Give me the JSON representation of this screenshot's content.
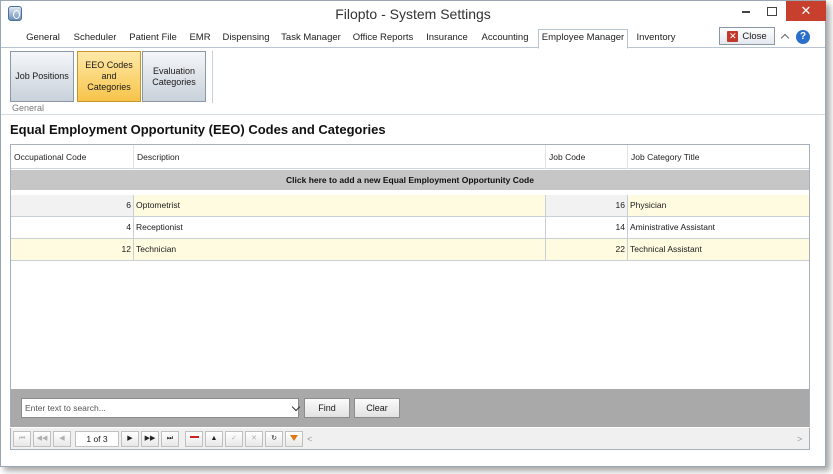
{
  "window": {
    "title": "Filopto - System Settings",
    "close_glyph": "✕"
  },
  "tabs": [
    {
      "label": "General"
    },
    {
      "label": "Scheduler"
    },
    {
      "label": "Patient File"
    },
    {
      "label": "EMR"
    },
    {
      "label": "Dispensing"
    },
    {
      "label": "Task Manager"
    },
    {
      "label": "Office Reports"
    },
    {
      "label": "Insurance"
    },
    {
      "label": "Accounting"
    },
    {
      "label": "Employee Manager"
    },
    {
      "label": "Inventory"
    }
  ],
  "active_tab": "Employee Manager",
  "close_button": {
    "label": "Close",
    "glyph": "✕"
  },
  "help_glyph": "?",
  "ribbon": {
    "buttons": [
      {
        "label": "Job Positions"
      },
      {
        "label": "EEO Codes and Categories"
      },
      {
        "label": "Evaluation Categories"
      }
    ],
    "group_label": "General"
  },
  "heading": "Equal Employment Opportunity (EEO) Codes and Categories",
  "grid": {
    "columns": [
      "Occupational Code",
      "Description",
      "Job Code",
      "Job Category Title"
    ],
    "add_row_text": "Click here to add a new Equal Employment Opportunity Code",
    "rows": [
      {
        "code": "6",
        "description": "Optometrist",
        "job_code": "16",
        "title": "Physician"
      },
      {
        "code": "4",
        "description": "Receptionist",
        "job_code": "14",
        "title": "Aministrative Assistant"
      },
      {
        "code": "12",
        "description": "Technician",
        "job_code": "22",
        "title": "Technical Assistant"
      }
    ]
  },
  "search": {
    "placeholder": "Enter text to search...",
    "find_label": "Find",
    "clear_label": "Clear"
  },
  "navigator": {
    "page_text": "1 of 3",
    "glyphs": {
      "first": "⏮",
      "prev_page": "◀◀",
      "prev": "◀",
      "next": "▶",
      "next_page": "▶▶",
      "last": "⏭",
      "up": "▲",
      "check": "✓",
      "cancel": "✕",
      "refresh": "↻",
      "scroll_left": "<",
      "scroll_right": ">"
    }
  },
  "colors": {
    "selected_ribbon": "#f7c44a",
    "alt_row": "#fffbe0",
    "add_row_bg": "#c6c6c6",
    "close_red": "#c7402e",
    "help_blue": "#2a6fc9"
  }
}
